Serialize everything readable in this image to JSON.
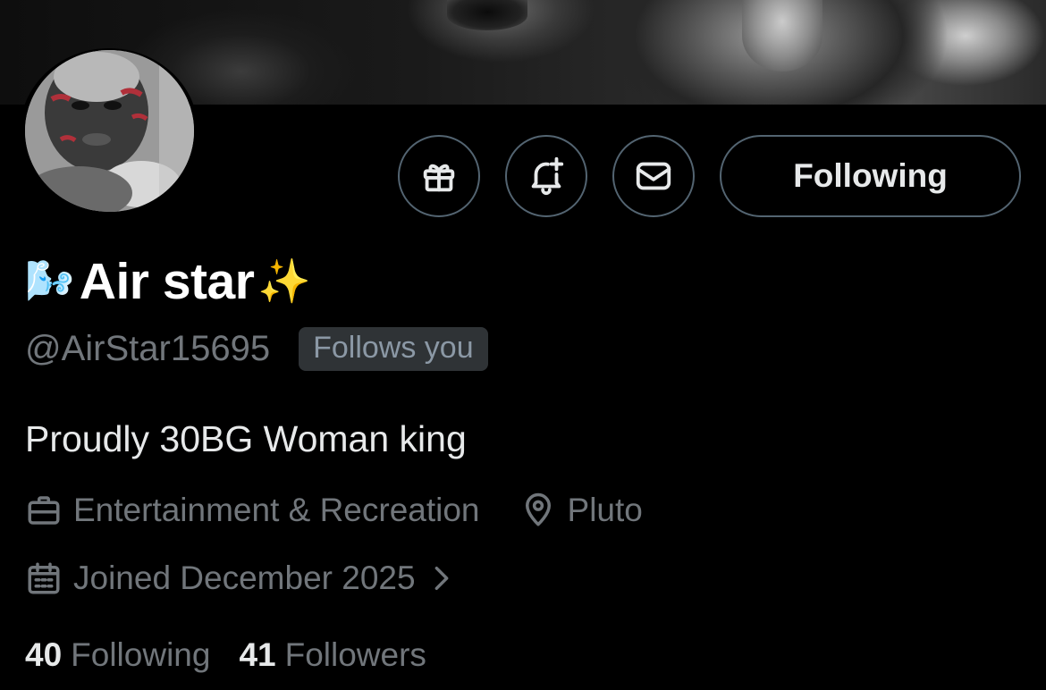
{
  "profile": {
    "display_name_prefix_emoji": "🌬️",
    "display_name": "Air star",
    "display_name_suffix_emoji": "✨",
    "handle": "@AirStar15695",
    "follows_you_badge": "Follows you",
    "bio": "Proudly 30BG Woman king",
    "category": "Entertainment & Recreation",
    "location": "Pluto",
    "joined": "Joined December 2025"
  },
  "actions": {
    "following_button": "Following",
    "icons": [
      "gift-icon",
      "notification-bell-plus-icon",
      "mail-icon"
    ]
  },
  "stats": {
    "following_count": "40",
    "following_label": "Following",
    "followers_count": "41",
    "followers_label": "Followers"
  },
  "colors": {
    "background": "#000000",
    "primary_text": "#e7e9ea",
    "secondary_text": "#71767b",
    "border": "#536471",
    "badge_bg": "#2f3336"
  }
}
